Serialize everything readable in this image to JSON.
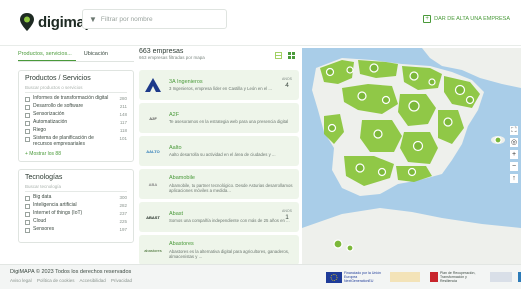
{
  "header": {
    "brand": "digimapa",
    "search_placeholder": "Filtrar por nombre",
    "register_label": "DAR DE ALTA UNA EMPRESA"
  },
  "sidebar": {
    "tabs": [
      {
        "label": "Productos, servicios...",
        "active": true
      },
      {
        "label": "Ubicación",
        "active": false
      }
    ],
    "products": {
      "title": "Productos / Servicios",
      "search_placeholder": "Buscar productos o servicios",
      "items": [
        {
          "label": "Informes de transformación digital",
          "count": "280"
        },
        {
          "label": "Desarrollo de software",
          "count": "211"
        },
        {
          "label": "Sensorización",
          "count": "148"
        },
        {
          "label": "Automatización",
          "count": "117"
        },
        {
          "label": "Riego",
          "count": "118"
        },
        {
          "label": "Sistema de planificación de recursos empresariales",
          "count": "101"
        }
      ],
      "show_more": "+ Mostrar los 88"
    },
    "technologies": {
      "title": "Tecnologías",
      "search_placeholder": "Buscar tecnología",
      "items": [
        {
          "label": "Big data",
          "count": "300"
        },
        {
          "label": "Inteligencia artificial",
          "count": "282"
        },
        {
          "label": "Internet of things (IoT)",
          "count": "237"
        },
        {
          "label": "Cloud",
          "count": "225"
        },
        {
          "label": "Sensores",
          "count": "197"
        }
      ]
    }
  },
  "list": {
    "count_title": "663 empresas",
    "count_sub": "663 empresas filtradas por mapa",
    "cards": [
      {
        "name": "3A Ingenieros",
        "desc": "3 Ingenieros, empresa líder en Castilla y León en el ...",
        "logo": "3A",
        "badge_label": "ANOS",
        "badge_num": "4"
      },
      {
        "name": "A2F",
        "desc": "Te asesoramos en la estrategia web para una presencia digital",
        "logo": "A2F",
        "badge_label": "",
        "badge_num": ""
      },
      {
        "name": "Aalto",
        "desc": "Aalto desarrolla su actividad en el área de ciudades y ...",
        "logo": "AALTO",
        "badge_label": "",
        "badge_num": ""
      },
      {
        "name": "Abamobile",
        "desc": "Abamobile, tu partner tecnológico. Desde Asturias desarrollamos aplicaciones móviles a medida...",
        "logo": "ABA",
        "badge_label": "",
        "badge_num": ""
      },
      {
        "name": "Abast",
        "desc": "Somos una compañía independiente con más de 25 años en ...",
        "logo": "ABAST",
        "badge_label": "ANOS",
        "badge_num": "1"
      },
      {
        "name": "Abastores",
        "desc": "Abastores es la alternativa digital para agricultores, ganaderos, almacenistas y ...",
        "logo": "abastores",
        "badge_label": "",
        "badge_num": ""
      }
    ]
  },
  "footer": {
    "copyright": "DigiMAPA © 2023 Todos los derechos reservados",
    "links": [
      "Aviso legal",
      "Política de cookies",
      "Accesibilidad",
      "Privacidad"
    ],
    "funding": [
      "Financiado por la Unión Europea NextGenerationEU",
      "Plan de Recuperación, Transformación y Resiliencia"
    ]
  },
  "colors": {
    "accent": "#4a9a3a",
    "card_bg": "#eef5ea",
    "sea": "#a9cde8",
    "land": "#eef0ec",
    "cluster": "#8cc63f"
  }
}
